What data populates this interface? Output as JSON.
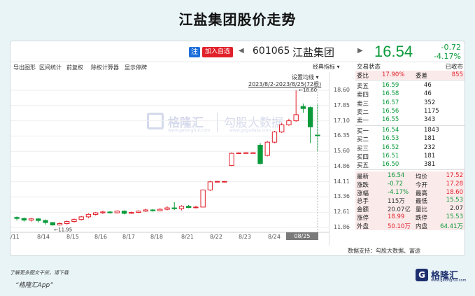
{
  "page_title": "江盐集团股价走势",
  "topbar": {
    "zhu": "注",
    "add_watchlist": "加入自选",
    "code": "601065",
    "name": "江盐集团",
    "price": "16.54",
    "change": "-0.72",
    "change_pct": "-4.17%"
  },
  "toolbar": {
    "items": [
      "导出图形",
      "区间统计",
      "前复权",
      "除权计算器",
      "显示停牌"
    ],
    "indicator": "经典指标"
  },
  "chart": {
    "settings_label": "设置均线",
    "range_label": "2023/8/2-2023/8/25(72根)",
    "high_label": "18.60",
    "low_label": "11.95",
    "time_label": "08/25 15:00"
  },
  "chart_data": {
    "type": "candlestick",
    "y_ticks": [
      "18.60",
      "17.85",
      "17.10",
      "16.35",
      "15.60",
      "14.86",
      "14.11",
      "13.36",
      "12.61",
      "11.86"
    ],
    "ylim": [
      11.86,
      18.6
    ],
    "x_ticks": [
      "/11",
      "8/14",
      "8/15",
      "8/16",
      "8/17",
      "8/18",
      "8/21",
      "8/22",
      "8/23",
      "8/24"
    ],
    "candles": [
      {
        "o": 12.35,
        "c": 12.3,
        "h": 12.4,
        "l": 12.2
      },
      {
        "o": 12.3,
        "c": 12.22,
        "h": 12.35,
        "l": 12.15
      },
      {
        "o": 12.22,
        "c": 12.28,
        "h": 12.32,
        "l": 12.15
      },
      {
        "o": 12.28,
        "c": 12.2,
        "h": 12.32,
        "l": 12.1
      },
      {
        "o": 12.2,
        "c": 12.1,
        "h": 12.25,
        "l": 12.0
      },
      {
        "o": 12.1,
        "c": 11.98,
        "h": 12.12,
        "l": 11.95
      },
      {
        "o": 11.98,
        "c": 12.05,
        "h": 12.1,
        "l": 11.95
      },
      {
        "o": 12.05,
        "c": 12.15,
        "h": 12.2,
        "l": 12.0
      },
      {
        "o": 12.15,
        "c": 12.25,
        "h": 12.3,
        "l": 12.1
      },
      {
        "o": 12.25,
        "c": 12.38,
        "h": 12.42,
        "l": 12.2
      },
      {
        "o": 12.38,
        "c": 12.5,
        "h": 12.55,
        "l": 12.32
      },
      {
        "o": 12.5,
        "c": 12.58,
        "h": 12.62,
        "l": 12.45
      },
      {
        "o": 12.58,
        "c": 12.62,
        "h": 12.68,
        "l": 12.52
      },
      {
        "o": 12.62,
        "c": 12.58,
        "h": 12.66,
        "l": 12.54
      },
      {
        "o": 12.58,
        "c": 12.66,
        "h": 12.7,
        "l": 12.55
      },
      {
        "o": 12.66,
        "c": 12.55,
        "h": 12.7,
        "l": 12.5
      },
      {
        "o": 12.55,
        "c": 12.6,
        "h": 12.64,
        "l": 12.52
      },
      {
        "o": 12.6,
        "c": 12.66,
        "h": 12.7,
        "l": 12.56
      },
      {
        "o": 12.66,
        "c": 12.72,
        "h": 12.78,
        "l": 12.62
      },
      {
        "o": 12.72,
        "c": 12.68,
        "h": 12.76,
        "l": 12.64
      },
      {
        "o": 12.68,
        "c": 12.75,
        "h": 12.8,
        "l": 12.65
      },
      {
        "o": 12.75,
        "c": 12.82,
        "h": 12.9,
        "l": 12.7
      },
      {
        "o": 12.82,
        "c": 12.78,
        "h": 13.1,
        "l": 12.72
      },
      {
        "o": 12.78,
        "c": 12.9,
        "h": 12.95,
        "l": 12.7
      },
      {
        "o": 12.9,
        "c": 12.84,
        "h": 12.96,
        "l": 12.8
      },
      {
        "o": 12.84,
        "c": 12.86,
        "h": 12.92,
        "l": 12.8
      },
      {
        "o": 12.86,
        "c": 13.7,
        "h": 13.72,
        "l": 12.86
      },
      {
        "o": 13.7,
        "c": 14.1,
        "h": 14.15,
        "l": 13.65
      },
      {
        "o": 14.1,
        "c": 14.12,
        "h": 14.15,
        "l": 14.08
      },
      {
        "o": 14.12,
        "c": 14.12,
        "h": 14.14,
        "l": 14.1
      },
      {
        "o": 14.9,
        "c": 15.5,
        "h": 15.55,
        "l": 14.88
      },
      {
        "o": 15.5,
        "c": 15.52,
        "h": 15.55,
        "l": 15.48
      },
      {
        "o": 15.52,
        "c": 15.53,
        "h": 15.55,
        "l": 15.5
      },
      {
        "o": 15.53,
        "c": 15.53,
        "h": 15.55,
        "l": 15.52
      },
      {
        "o": 15.9,
        "c": 15.0,
        "h": 16.0,
        "l": 14.95
      },
      {
        "o": 15.4,
        "c": 16.05,
        "h": 16.1,
        "l": 15.35
      },
      {
        "o": 16.05,
        "c": 16.55,
        "h": 16.6,
        "l": 16.0
      },
      {
        "o": 16.55,
        "c": 16.9,
        "h": 17.0,
        "l": 16.5
      },
      {
        "o": 16.9,
        "c": 17.1,
        "h": 17.2,
        "l": 16.85
      },
      {
        "o": 17.1,
        "c": 17.4,
        "h": 18.6,
        "l": 17.05
      },
      {
        "o": 17.8,
        "c": 17.7,
        "h": 17.95,
        "l": 17.5
      },
      {
        "o": 17.75,
        "c": 16.8,
        "h": 17.8,
        "l": 16.0
      },
      {
        "o": 16.4,
        "c": 16.38,
        "h": 17.9,
        "l": 15.6
      }
    ]
  },
  "side_panel": {
    "header_left": "交易状态",
    "header_right": "已收市",
    "webi_label": "委比",
    "webi_value": "17.90%",
    "weicha_label": "委差",
    "weicha_value": "855",
    "asks": [
      {
        "label": "卖五",
        "price": "16.59",
        "vol": "46"
      },
      {
        "label": "卖四",
        "price": "16.58",
        "vol": "46"
      },
      {
        "label": "卖三",
        "price": "16.57",
        "vol": "352"
      },
      {
        "label": "卖二",
        "price": "16.56",
        "vol": "1175"
      },
      {
        "label": "卖一",
        "price": "16.55",
        "vol": "343"
      }
    ],
    "bids": [
      {
        "label": "买一",
        "price": "16.54",
        "vol": "1843"
      },
      {
        "label": "买二",
        "price": "16.53",
        "vol": "181"
      },
      {
        "label": "买三",
        "price": "16.52",
        "vol": "232"
      },
      {
        "label": "买四",
        "price": "16.51",
        "vol": "181"
      },
      {
        "label": "买五",
        "price": "16.50",
        "vol": "381"
      }
    ],
    "stats": [
      {
        "l1": "最新",
        "v1": "16.54",
        "c1": "green",
        "l2": "均价",
        "v2": "17.52",
        "c2": "red"
      },
      {
        "l1": "涨跌",
        "v1": "-0.72",
        "c1": "green",
        "l2": "今开",
        "v2": "17.28",
        "c2": "red"
      },
      {
        "l1": "涨幅",
        "v1": "-4.17%",
        "c1": "green",
        "l2": "最高",
        "v2": "18.60",
        "c2": "red"
      },
      {
        "l1": "总手",
        "v1": "115万",
        "c1": "gray",
        "l2": "最低",
        "v2": "15.53",
        "c2": "green"
      },
      {
        "l1": "金额",
        "v1": "20.07亿",
        "c1": "gray",
        "l2": "量比",
        "v2": "2.07",
        "c2": "gray"
      },
      {
        "l1": "涨停",
        "v1": "18.99",
        "c1": "red",
        "l2": "跌停",
        "v2": "15.53",
        "c2": "green"
      },
      {
        "l1": "外盘",
        "v1": "50.10万",
        "c1": "red",
        "l2": "内盘",
        "v2": "64.41万",
        "c2": "green"
      }
    ]
  },
  "source_note": "数据支持：勾股大数据、富途",
  "watermark": {
    "brand": "格隆汇",
    "sub1": "www.gelonghui.com",
    "brand2": "勾股大数据",
    "sub2": "www.gogudata.com"
  },
  "footer": {
    "line1": "了解更多图文干货，请下载",
    "line2": "“格隆汇App”",
    "logo_text": "格隆汇",
    "logo_letter": "G",
    "logo_sub": "www.gelonghui.com"
  },
  "colors": {
    "up": "#e0202a",
    "down": "#0a9a3a",
    "accent": "#1e6fd9"
  }
}
